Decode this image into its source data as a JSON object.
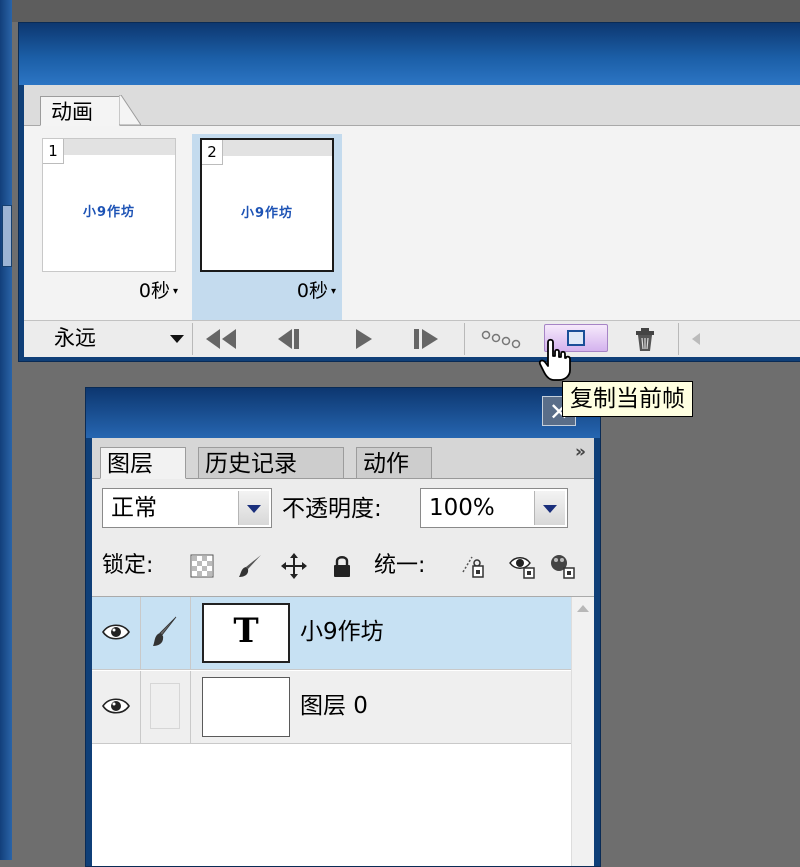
{
  "animation_panel": {
    "tab_label": "动画",
    "frames": [
      {
        "number": "1",
        "content_text": "小9作坊",
        "delay": "0秒"
      },
      {
        "number": "2",
        "content_text": "小9作坊",
        "delay": "0秒"
      }
    ],
    "selected_frame": 2,
    "loop_option": "永远",
    "tooltip": "复制当前帧"
  },
  "layers_panel": {
    "tabs": [
      "图层",
      "历史记录",
      "动作"
    ],
    "active_tab": "图层",
    "menu_arrows": "»",
    "close_glyph": "✕",
    "blend_mode": "正常",
    "opacity_label": "不透明度:",
    "opacity_value": "100%",
    "lock_label": "锁定:",
    "unify_label": "统一:",
    "layers": [
      {
        "name": "小9作坊",
        "thumb_glyph": "T",
        "type": "text",
        "visible": true
      },
      {
        "name": "图层 0",
        "thumb_glyph": "",
        "type": "normal",
        "visible": true
      }
    ],
    "selected_layer": "小9作坊"
  },
  "colors": {
    "titlebar_blue": "#1b5ea6",
    "selection_blue": "#c7e1f3",
    "frame_text_blue": "#1d53b5",
    "tooltip_bg": "#ffffe1",
    "active_button_purple": "#d4b3ee"
  }
}
